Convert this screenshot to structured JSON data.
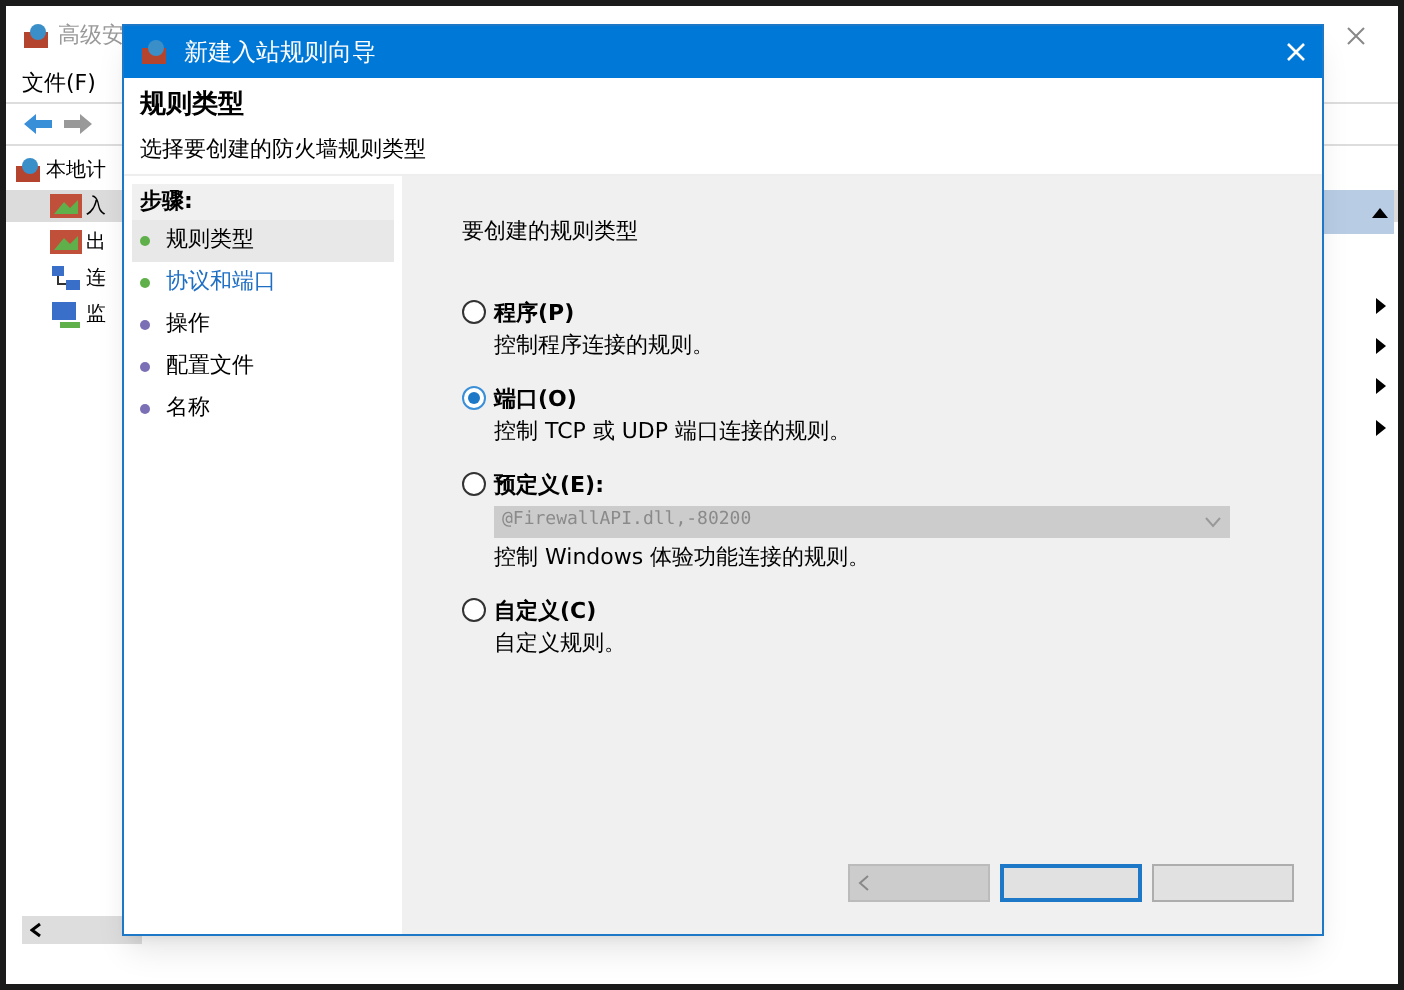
{
  "background_window": {
    "title": "高级安",
    "menu": [
      "文件(F)"
    ],
    "tree": [
      {
        "label": "本地计",
        "kind": "root"
      },
      {
        "label": "入",
        "kind": "rule",
        "selected": true
      },
      {
        "label": "出",
        "kind": "rule",
        "selected": false
      },
      {
        "label": "连",
        "kind": "connection",
        "selected": false
      },
      {
        "label": "监",
        "kind": "monitor",
        "selected": false
      }
    ]
  },
  "dialog": {
    "title": "新建入站规则向导",
    "heading": "规则类型",
    "subheading": "选择要创建的防火墙规则类型",
    "steps_title": "步骤:",
    "steps": [
      {
        "label": "规则类型",
        "kind": "done",
        "selected": true
      },
      {
        "label": "协议和端口",
        "kind": "next",
        "selected": false
      },
      {
        "label": "操作",
        "kind": "pending",
        "selected": false
      },
      {
        "label": "配置文件",
        "kind": "pending",
        "selected": false
      },
      {
        "label": "名称",
        "kind": "pending",
        "selected": false
      }
    ],
    "prompt": "要创建的规则类型",
    "options": [
      {
        "label": "程序(P)",
        "description": "控制程序连接的规则。",
        "selected": false
      },
      {
        "label": "端口(O)",
        "description": "控制 TCP 或 UDP 端口连接的规则。",
        "selected": true
      },
      {
        "label": "预定义(E):",
        "dropdown": {
          "value": "@FirewallAPI.dll,-80200",
          "disabled": true
        },
        "description": "控制 Windows 体验功能连接的规则。",
        "selected": false
      },
      {
        "label": "自定义(C)",
        "description": "自定义规则。",
        "selected": false
      }
    ],
    "buttons": [
      {
        "kind": "back",
        "disabled": true
      },
      {
        "kind": "next",
        "disabled": false
      },
      {
        "kind": "cancel",
        "disabled": false
      }
    ]
  }
}
